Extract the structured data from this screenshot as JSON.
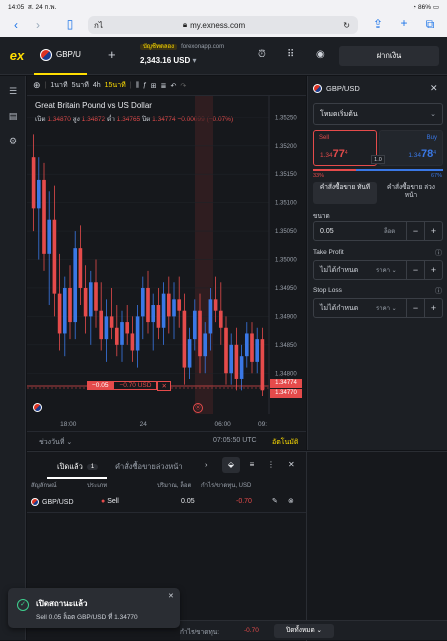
{
  "status_bar": {
    "time": "14:05",
    "date": "ส. 24 ก.พ.",
    "battery": "86%"
  },
  "browser": {
    "tab_text": "กไ",
    "url": "my.exness.com"
  },
  "app": {
    "logo": "ex",
    "instrument_tab": "GBP/U",
    "account_demo_badge": "บัญชีทดลอง",
    "account_server": "forexonapp.com",
    "balance": "2,343.16 USD",
    "deposit_label": "ฝากเงิน"
  },
  "chart": {
    "timeframes": [
      {
        "label": "1นาที",
        "active": false
      },
      {
        "label": "5นาที",
        "active": false
      },
      {
        "label": "4h",
        "active": false
      },
      {
        "label": "15นาที",
        "active": true
      }
    ],
    "title": "Great Britain Pound vs US Dollar",
    "ohlc": {
      "open_label": "เปิด",
      "open": "1.34870",
      "high_label": "สูง",
      "high": "1.34872",
      "low_label": "ต่ำ",
      "low": "1.34765",
      "close_label": "ปิด",
      "close": "1.34774",
      "change": "−0.00099 (−0.07%)"
    },
    "price_ticks": [
      "1.35250",
      "1.35200",
      "1.35150",
      "1.35100",
      "1.35050",
      "1.35000",
      "1.34950",
      "1.34900",
      "1.34850",
      "1.34800"
    ],
    "price_tag_bid": "1.34774",
    "price_tag_ask": "1.34770",
    "time_ticks": [
      "18:00",
      "24",
      "06:00",
      "09:"
    ],
    "position_line_left": "−0.05",
    "position_line_pl": "−0.70 USD",
    "range_label": "ช่วงวันที่",
    "clock": "07:05:50 UTC",
    "auto_label": "อัตโนมัติ"
  },
  "order_panel": {
    "symbol": "GBP/USD",
    "mode": "โหมดเริ่มต้น",
    "sell_label": "Sell",
    "sell_price_small": "1.34",
    "sell_price_big": "77",
    "sell_price_sup": "4",
    "buy_label": "Buy",
    "buy_price_small": "1.34",
    "buy_price_big": "78",
    "buy_price_sup": "4",
    "spread": "1.0",
    "sentiment_sell": "33%",
    "sentiment_buy": "67%",
    "tab_market": "คำสั่งซื้อขาย ทันที",
    "tab_pending": "คำสั่งซื้อขาย ล่วงหน้า",
    "volume_label": "ขนาด",
    "volume_value": "0.05",
    "volume_unit": "ล็อต",
    "tp_label": "Take Profit",
    "tp_placeholder": "ไม่ได้กำหนด",
    "tp_unit": "ราคา",
    "sl_label": "Stop Loss",
    "sl_placeholder": "ไม่ได้กำหนด",
    "sl_unit": "ราคา"
  },
  "positions": {
    "tab_open": "เปิดแล้ว",
    "tab_open_count": "1",
    "tab_pending": "คำสั่งซื้อขายล่วงหน้า",
    "headers": [
      "สัญลักษณ์",
      "ประเภท",
      "ปริมาณ, ล็อต",
      "กำไร/ขาดทุน, USD"
    ],
    "rows": [
      {
        "symbol": "GBP/USD",
        "type": "Sell",
        "volume": "0.05",
        "pl": "-0.70"
      }
    ]
  },
  "toast": {
    "title": "เปิดสถานะแล้ว",
    "message": "Sell 0.05 ล็อต GBP/USD ที่ 1.34770"
  },
  "footer": {
    "pl_label": "กำไร/ขาดทุน:",
    "pl_value": "-0.70",
    "close_all": "ปิดทั้งหมด"
  },
  "colors": {
    "up": "#3a78e6",
    "down": "#e54b4b",
    "accent": "#ffde02",
    "sell": "#e54b4b",
    "buy": "#3a78e6"
  },
  "chart_data": {
    "type": "candlestick",
    "y_range": [
      1.3476,
      1.3527
    ],
    "candles": [
      [
        1.3518,
        1.3522,
        1.3505,
        1.3509
      ],
      [
        1.3509,
        1.3518,
        1.35,
        1.3514
      ],
      [
        1.3514,
        1.3517,
        1.3498,
        1.3501
      ],
      [
        1.3501,
        1.3512,
        1.3492,
        1.3507
      ],
      [
        1.3507,
        1.3513,
        1.349,
        1.3494
      ],
      [
        1.3494,
        1.3501,
        1.3484,
        1.3487
      ],
      [
        1.3487,
        1.3497,
        1.3483,
        1.3495
      ],
      [
        1.3495,
        1.3499,
        1.3486,
        1.3489
      ],
      [
        1.3489,
        1.3505,
        1.3486,
        1.3502
      ],
      [
        1.3502,
        1.3506,
        1.3492,
        1.3495
      ],
      [
        1.3495,
        1.3499,
        1.3487,
        1.349
      ],
      [
        1.349,
        1.3498,
        1.3485,
        1.3496
      ],
      [
        1.3496,
        1.35,
        1.3488,
        1.3491
      ],
      [
        1.3491,
        1.3496,
        1.3484,
        1.3486
      ],
      [
        1.3486,
        1.3493,
        1.3482,
        1.349
      ],
      [
        1.349,
        1.3495,
        1.3486,
        1.3488
      ],
      [
        1.3488,
        1.3492,
        1.3483,
        1.3485
      ],
      [
        1.3485,
        1.3491,
        1.3482,
        1.3489
      ],
      [
        1.3489,
        1.3492,
        1.3485,
        1.3487
      ],
      [
        1.3487,
        1.349,
        1.3482,
        1.3484
      ],
      [
        1.3484,
        1.3492,
        1.3481,
        1.349
      ],
      [
        1.349,
        1.3497,
        1.3486,
        1.3495
      ],
      [
        1.3495,
        1.3498,
        1.3487,
        1.3489
      ],
      [
        1.3489,
        1.3494,
        1.3484,
        1.3492
      ],
      [
        1.3492,
        1.3495,
        1.3486,
        1.3488
      ],
      [
        1.3488,
        1.3496,
        1.3485,
        1.3494
      ],
      [
        1.3494,
        1.3497,
        1.3487,
        1.349
      ],
      [
        1.349,
        1.3496,
        1.3486,
        1.3493
      ],
      [
        1.3493,
        1.3497,
        1.3488,
        1.3491
      ],
      [
        1.3491,
        1.3494,
        1.3478,
        1.3481
      ],
      [
        1.3481,
        1.3488,
        1.3479,
        1.3486
      ],
      [
        1.3486,
        1.3493,
        1.3484,
        1.3491
      ],
      [
        1.3491,
        1.3494,
        1.348,
        1.3483
      ],
      [
        1.3483,
        1.3489,
        1.348,
        1.3487
      ],
      [
        1.3487,
        1.3495,
        1.3484,
        1.3493
      ],
      [
        1.3493,
        1.3497,
        1.3489,
        1.3491
      ],
      [
        1.3491,
        1.3496,
        1.3485,
        1.3488
      ],
      [
        1.3488,
        1.349,
        1.3478,
        1.348
      ],
      [
        1.348,
        1.3487,
        1.3478,
        1.3485
      ],
      [
        1.3485,
        1.3488,
        1.3477,
        1.3479
      ],
      [
        1.3479,
        1.3485,
        1.3477,
        1.3483
      ],
      [
        1.3483,
        1.3489,
        1.3481,
        1.3487
      ],
      [
        1.3487,
        1.3489,
        1.348,
        1.3482
      ],
      [
        1.3482,
        1.3488,
        1.348,
        1.3486
      ],
      [
        1.3486,
        1.3488,
        1.3476,
        1.3477
      ]
    ]
  }
}
